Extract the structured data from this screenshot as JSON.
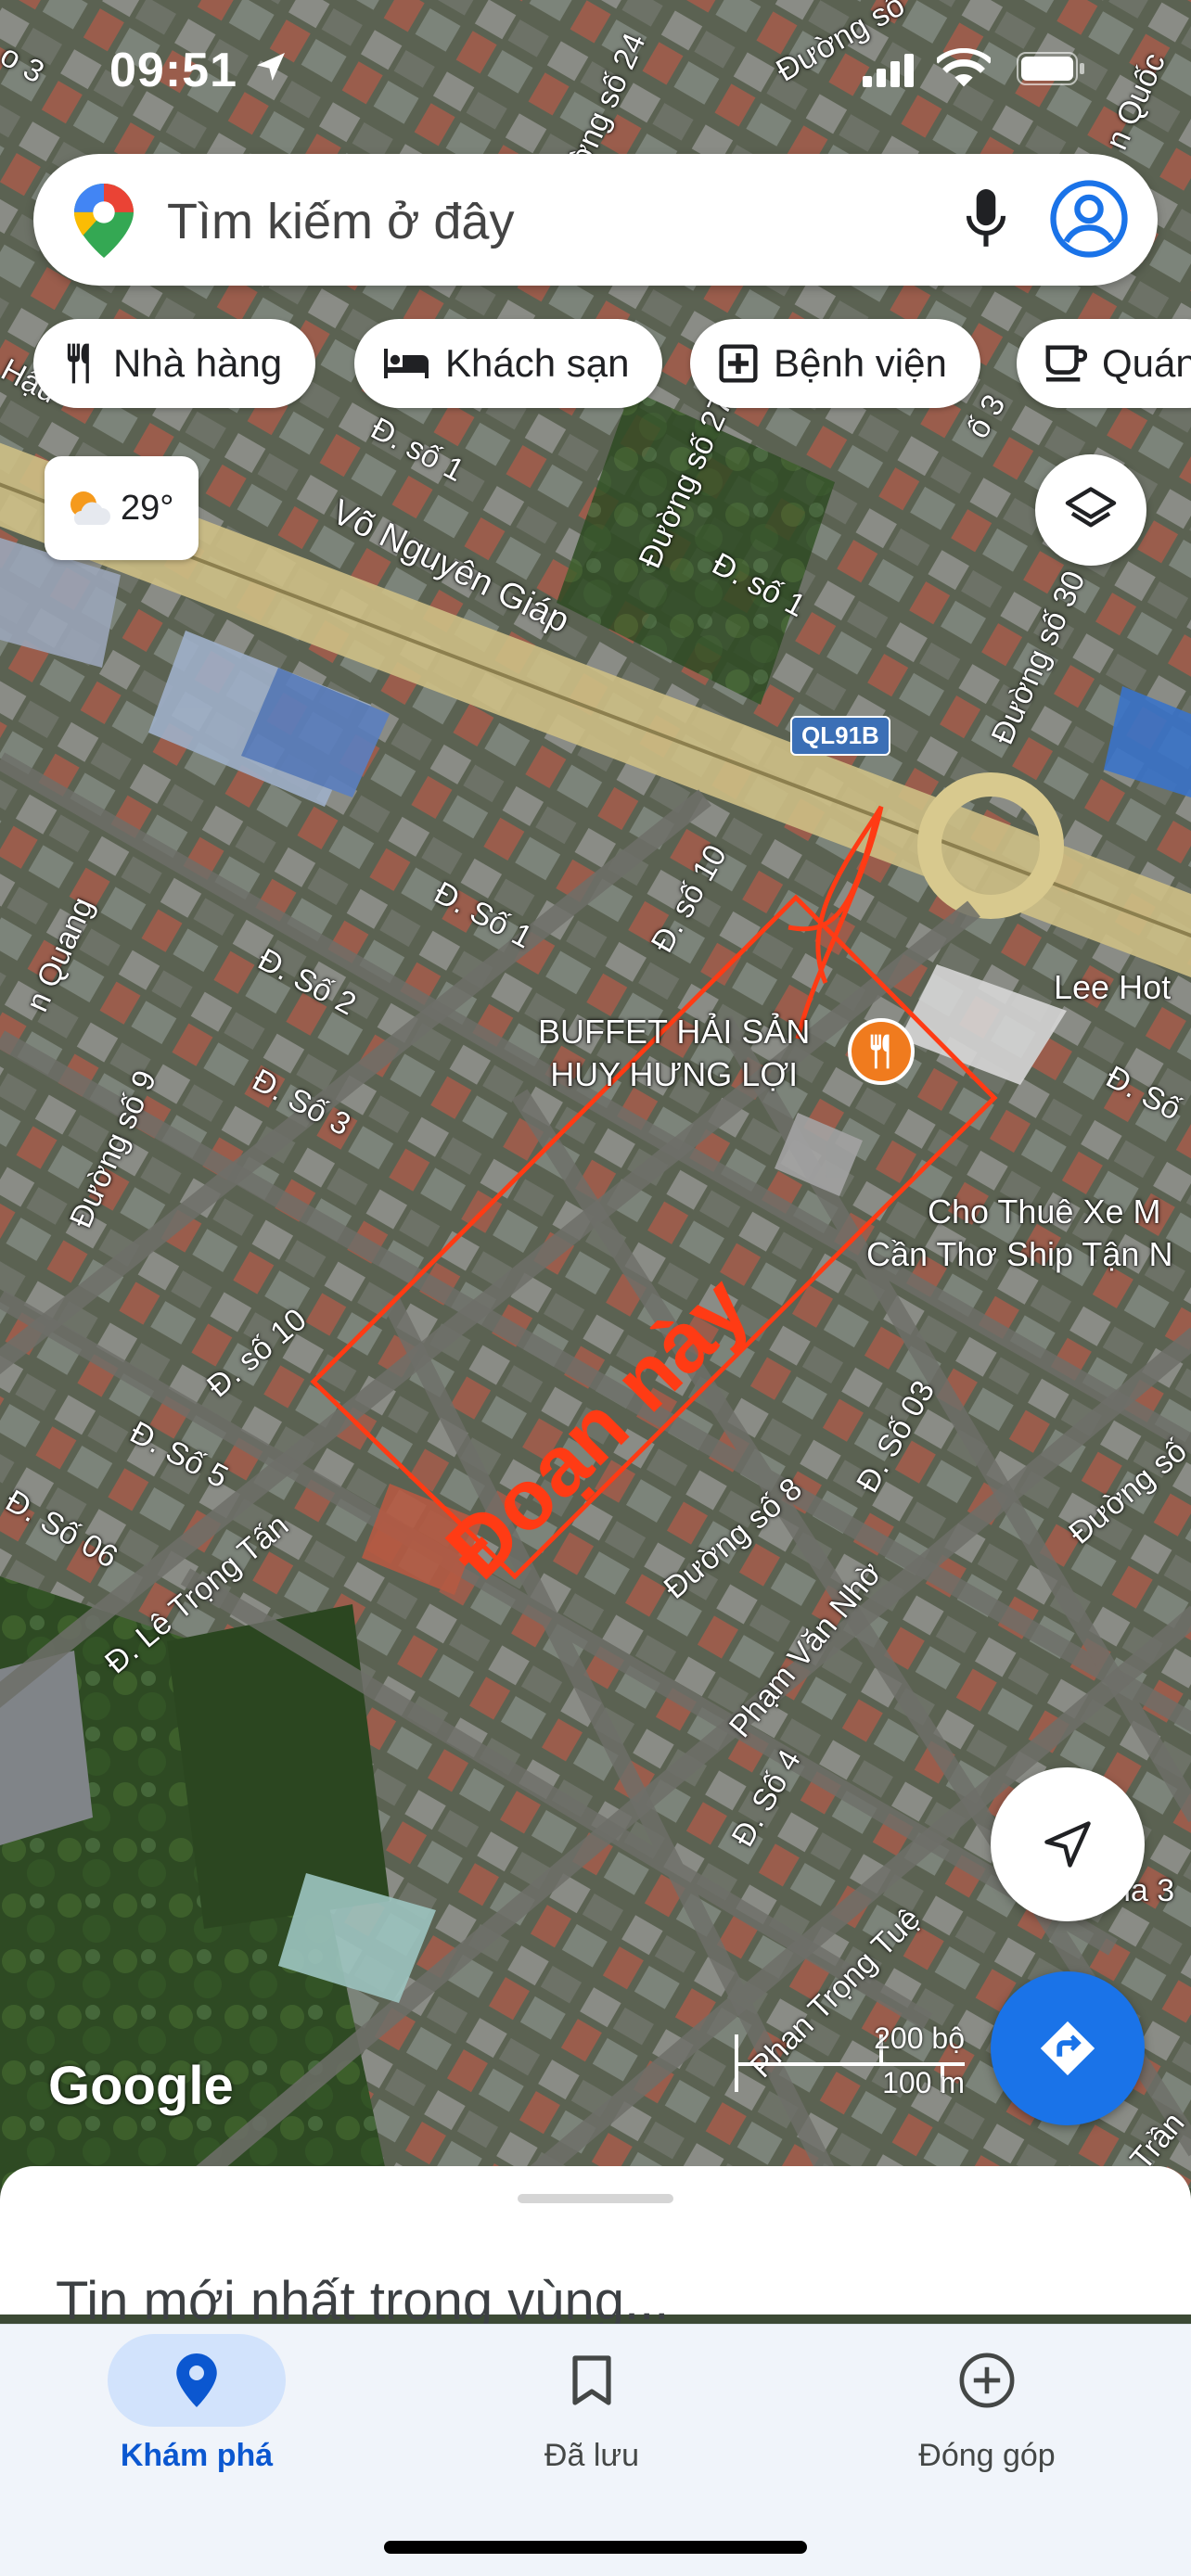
{
  "status_bar": {
    "time": "09:51"
  },
  "search": {
    "placeholder": "Tìm kiếm ở đây"
  },
  "chips": [
    {
      "label": "Nhà hàng",
      "icon": "restaurant-icon"
    },
    {
      "label": "Khách sạn",
      "icon": "hotel-icon"
    },
    {
      "label": "Bệnh viện",
      "icon": "hospital-icon"
    },
    {
      "label": "Quán",
      "icon": "cafe-icon"
    }
  ],
  "weather": {
    "temperature": "29°",
    "icon": "partly-cloudy-icon"
  },
  "map": {
    "road_badge": "QL91B",
    "annotation_text": "Đoạn này",
    "poi_restaurant": {
      "line1": "BUFFET HẢI SẢN",
      "line2": "HUY HƯNG LỢI"
    },
    "poi_car_rental": {
      "line1": "Cho Thuê Xe M",
      "line2": "Cần Thơ Ship Tận N"
    },
    "poi_hotel": "Lee Hot",
    "street_labels": {
      "vo_nguyen_giap": "Võ Nguyên Giáp",
      "duong_so_24": "Đường số 24",
      "duong_so_27": "Đường số 27",
      "duong_so_30": "Đường số 30",
      "d_so_1_a": "Đ. số 1",
      "d_so_1_b": "Đ. số 1",
      "d_so_1_c": "Đ. Số 1",
      "d_so_10_a": "Đ. số 10",
      "d_so_10_b": "Đ. số 10",
      "d_so_2": "Đ. Số 2",
      "d_so_3": "Đ. Số 3",
      "duong_so_9": "Đường số 9",
      "d_so_5": "Đ. Số 5",
      "d_so_06": "Đ. Số 06",
      "le_trong_tan": "Đ. Lê Trọng Tấn",
      "duong_so_8": "Đường số 8",
      "d_so_03": "Đ. Số 03",
      "pham_van_nho": "Phạm Văn Nhờ",
      "d_so_4": "Đ. Số 4",
      "phan_trong_tue": "Phan Trọng Tuệ",
      "hau": "Hậu",
      "quang": "n Quang",
      "quoc": "n Quốc",
      "duong_so": "Đường số",
      "so_3_top": "o 3",
      "so_3_right": "ố 3",
      "d_so_right": "Đ. Số",
      "ha_3": "na 3",
      "tran": "Trần",
      "duong_so_edge": "Đường số",
      "so_3_edge": "Số 3"
    },
    "scale": {
      "top": "200 bộ",
      "bottom": "100 m"
    },
    "logo": "Google"
  },
  "sheet": {
    "title": "Tin mới nhất trong vùng..."
  },
  "tabs": [
    {
      "label": "Khám phá",
      "active": true
    },
    {
      "label": "Đã lưu",
      "active": false
    },
    {
      "label": "Đóng góp",
      "active": false
    }
  ],
  "colors": {
    "accent": "#1a73e8",
    "annotation": "#ff3b14",
    "road": "#d8c98e"
  }
}
